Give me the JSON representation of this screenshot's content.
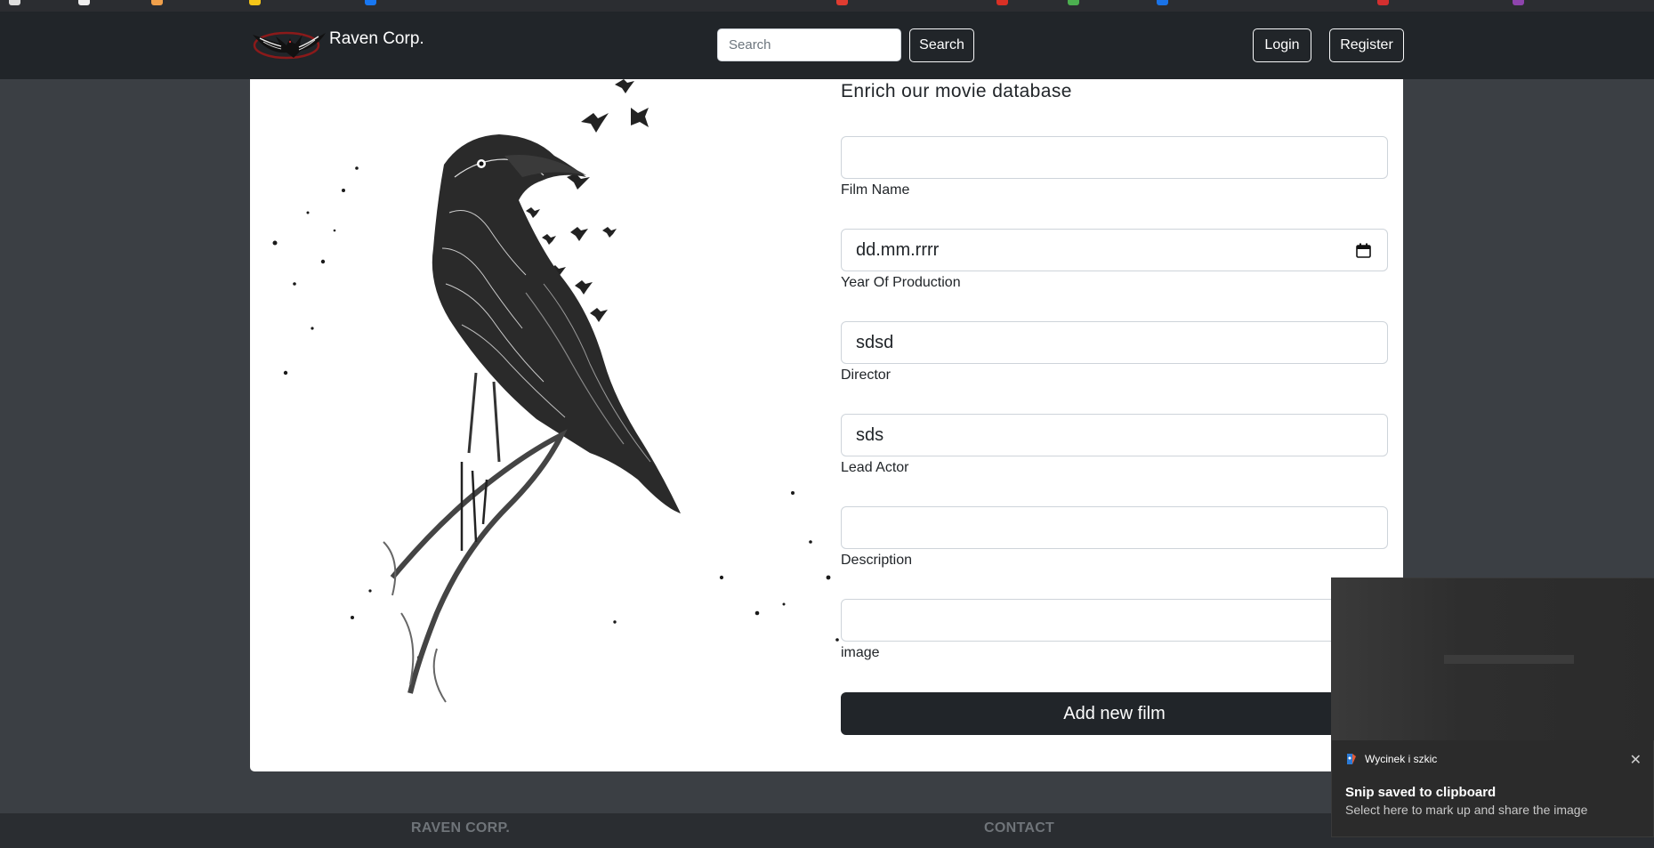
{
  "navbar": {
    "brand": "Raven Corp.",
    "search_placeholder": "Search",
    "search_button": "Search",
    "login_button": "Login",
    "register_button": "Register"
  },
  "form": {
    "heading": "Enrich our movie database",
    "fields": [
      {
        "label": "Film Name",
        "value": ""
      },
      {
        "label": "Year Of Production",
        "value": "dd.mm.rrrr"
      },
      {
        "label": "Director",
        "value": "sdsd"
      },
      {
        "label": "Lead Actor",
        "value": "sds"
      },
      {
        "label": "Description",
        "value": ""
      },
      {
        "label": "image",
        "value": ""
      }
    ],
    "submit_label": "Add new film"
  },
  "footer": {
    "col1": "RAVEN CORP.",
    "col2": "CONTACT"
  },
  "toast": {
    "app_name": "Wycinek i szkic",
    "title": "Snip saved to clipboard",
    "body": "Select here to mark up and share the image",
    "close": "✕"
  },
  "colors": {
    "navbar_bg": "#212529",
    "page_bg": "#3b3f44",
    "card_bg": "#ffffff",
    "button_dark": "#212529",
    "toast_bg": "#2b2b2b"
  }
}
